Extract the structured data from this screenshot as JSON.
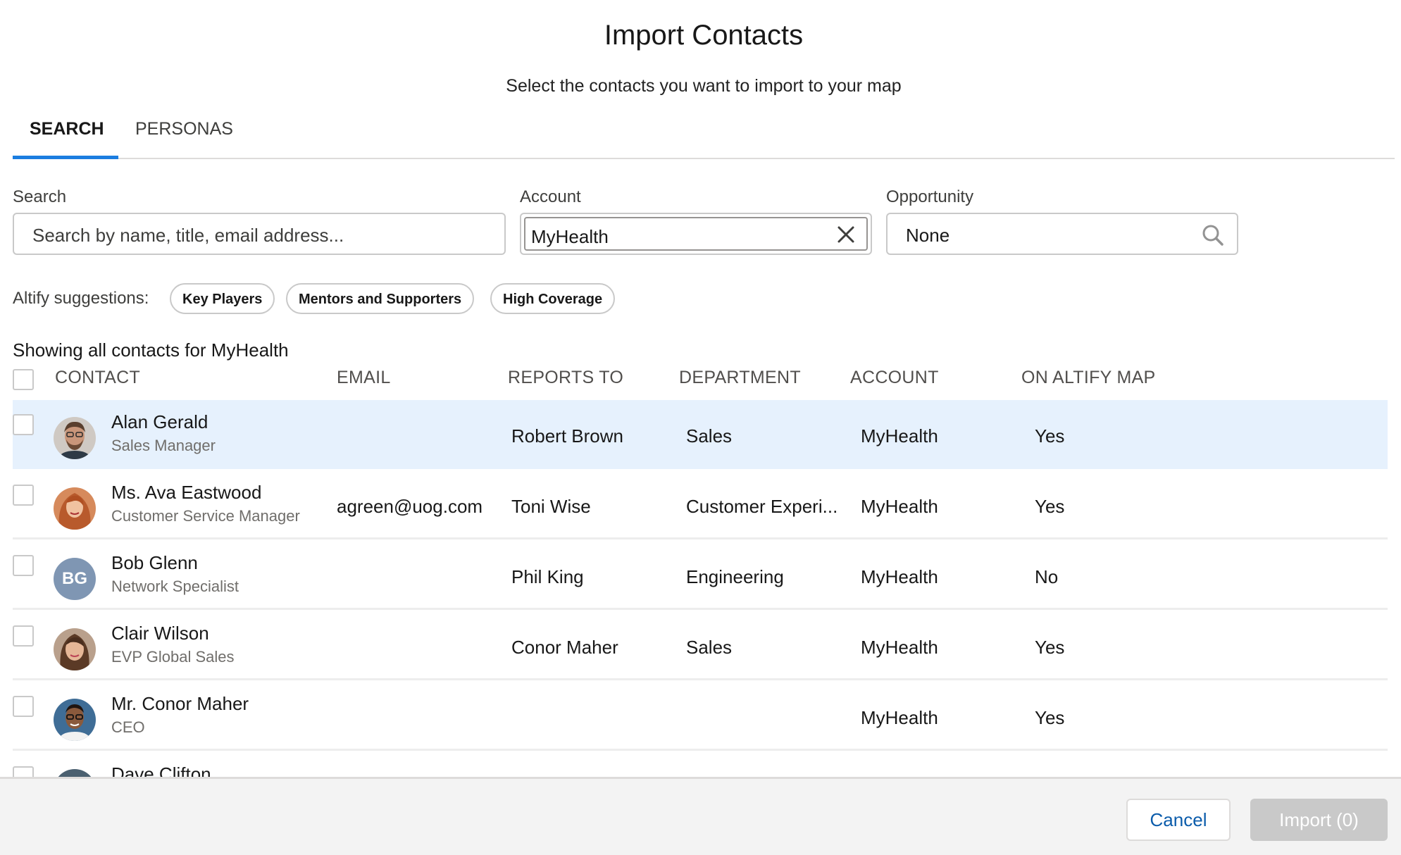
{
  "dialog": {
    "title": "Import Contacts",
    "subtitle": "Select the contacts you want to import to your map"
  },
  "tabs": [
    {
      "label": "SEARCH",
      "active": true
    },
    {
      "label": "PERSONAS",
      "active": false
    }
  ],
  "filters": {
    "search": {
      "label": "Search",
      "placeholder": "Search by name, title, email address..."
    },
    "account": {
      "label": "Account",
      "value": "MyHealth",
      "clear_icon": "close-icon"
    },
    "opportunity": {
      "label": "Opportunity",
      "value": "None",
      "icon": "search-icon"
    }
  },
  "suggestions": {
    "label": "Altify suggestions:",
    "chips": [
      "Key Players",
      "Mentors and Supporters",
      "High Coverage"
    ]
  },
  "results": {
    "showing_text": "Showing all contacts for MyHealth",
    "columns": [
      "CONTACT",
      "EMAIL",
      "REPORTS TO",
      "DEPARTMENT",
      "ACCOUNT",
      "ON ALTIFY MAP"
    ],
    "rows": [
      {
        "name": "Alan Gerald",
        "title": "Sales Manager",
        "email": "",
        "reports_to": "Robert Brown",
        "department": "Sales",
        "account": "MyHealth",
        "on_map": "Yes",
        "avatar": "photo-man-beard",
        "highlighted": true
      },
      {
        "name": "Ms. Ava Eastwood",
        "title": "Customer Service Manager",
        "email": "agreen@uog.com",
        "reports_to": "Toni Wise",
        "department": "Customer Experi...",
        "account": "MyHealth",
        "on_map": "Yes",
        "avatar": "photo-woman-red-hair"
      },
      {
        "name": "Bob Glenn",
        "title": "Network Specialist",
        "email": "",
        "reports_to": "Phil King",
        "department": "Engineering",
        "account": "MyHealth",
        "on_map": "No",
        "avatar_initials": "BG"
      },
      {
        "name": "Clair Wilson",
        "title": "EVP Global Sales",
        "email": "",
        "reports_to": "Conor Maher",
        "department": "Sales",
        "account": "MyHealth",
        "on_map": "Yes",
        "avatar": "photo-woman-brown-hair"
      },
      {
        "name": "Mr. Conor Maher",
        "title": "CEO",
        "email": "",
        "reports_to": "",
        "department": "",
        "account": "MyHealth",
        "on_map": "Yes",
        "avatar": "photo-man-glasses"
      },
      {
        "name": "Dave Clifton",
        "title": "",
        "partial": true
      }
    ]
  },
  "footer": {
    "cancel_label": "Cancel",
    "import_label": "Import (0)"
  },
  "colors": {
    "accent": "#1b7de0",
    "highlight_row": "#e6f1fd",
    "cancel_text": "#0b5cab",
    "import_disabled": "#c9c9c9"
  }
}
